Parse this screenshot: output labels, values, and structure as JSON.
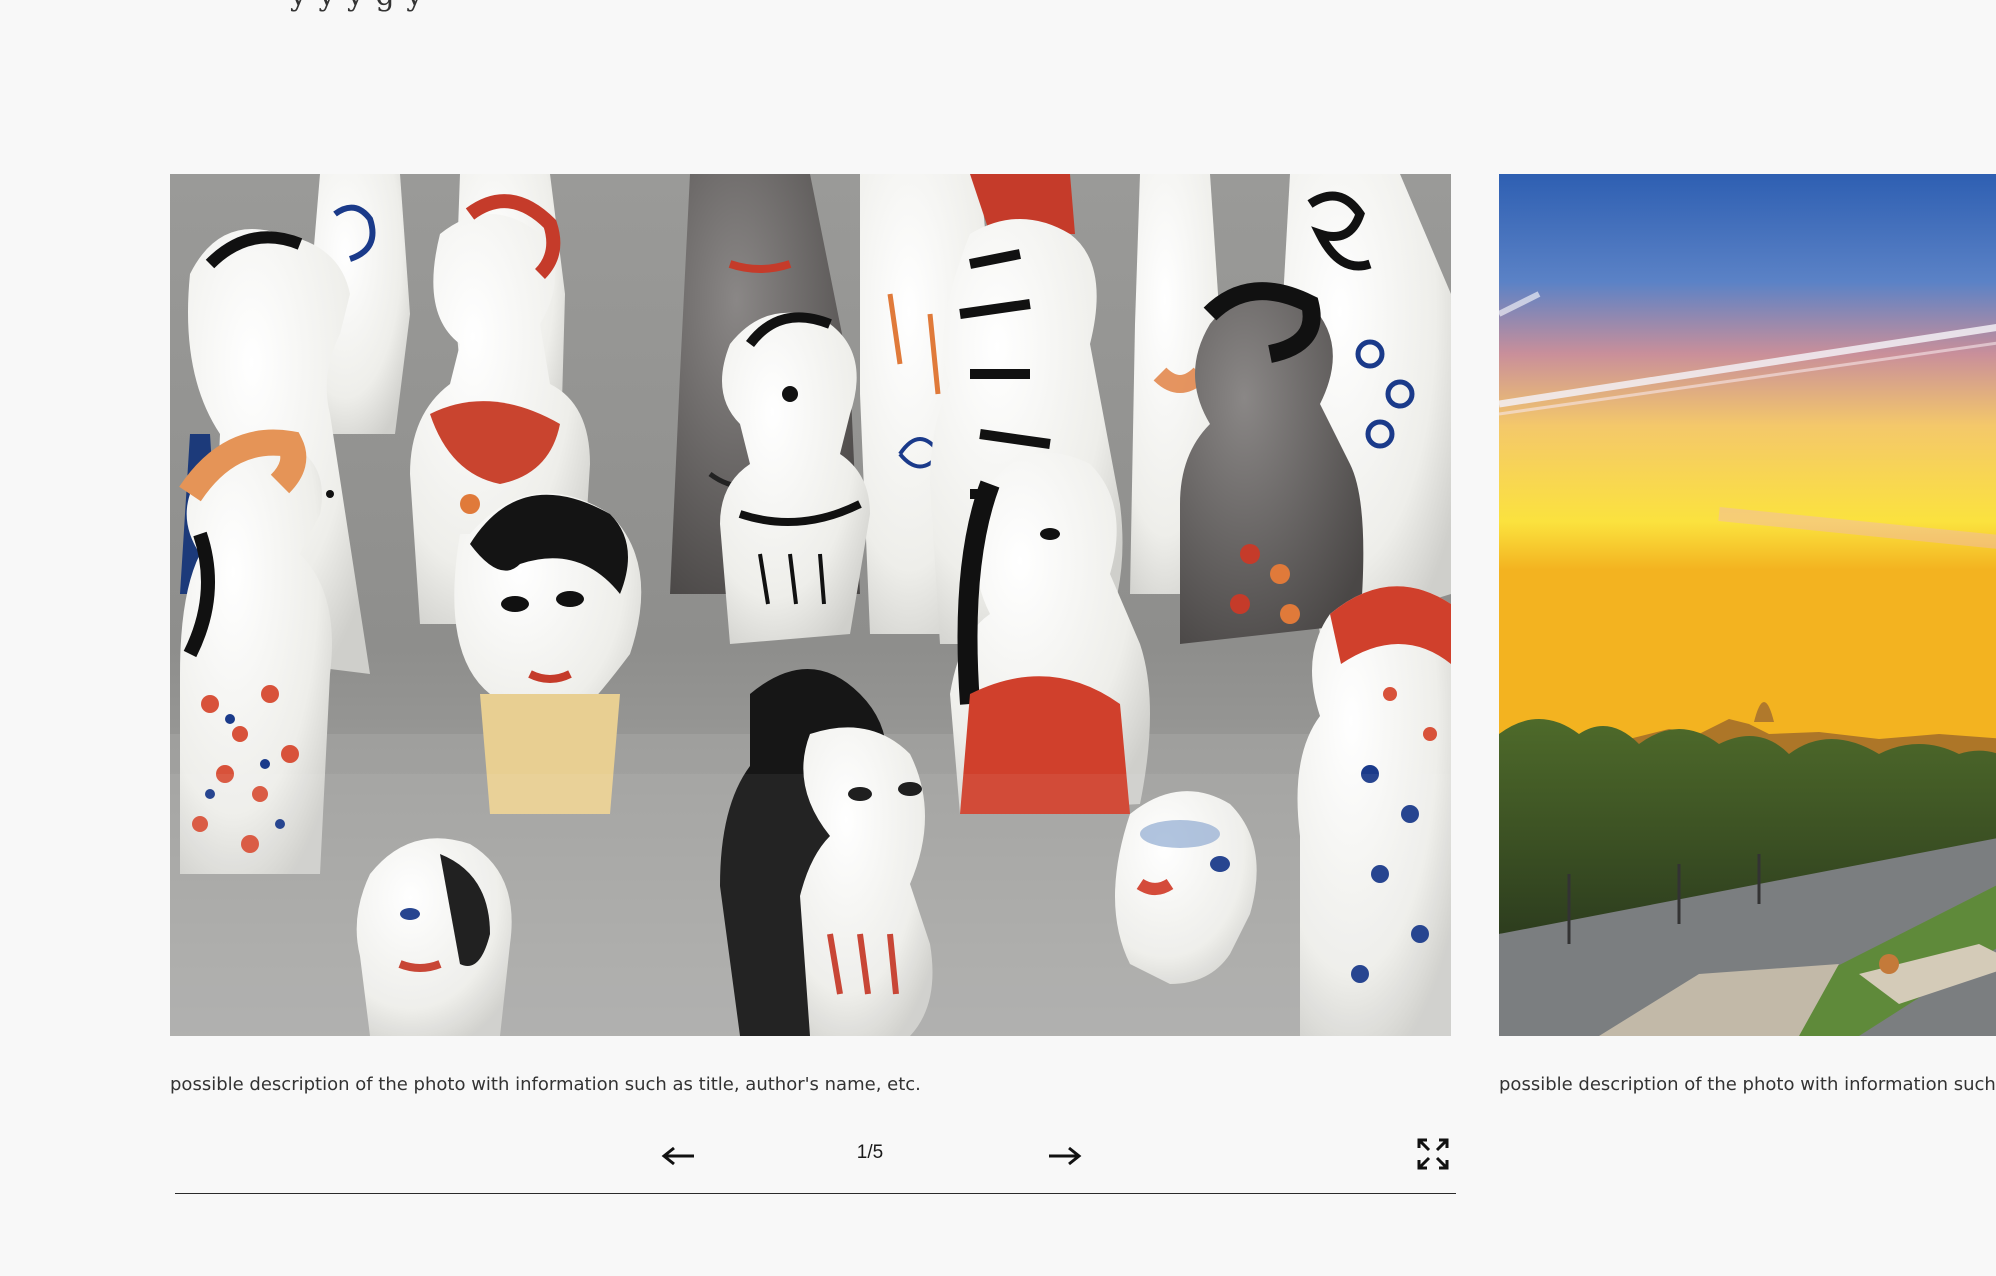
{
  "top_text_fragment": "y          y                y                    g          y",
  "slides": [
    {
      "image_alt": "Hand-painted ceramic figurines",
      "caption": "possible description of the photo with information such as title, author's name, etc."
    },
    {
      "image_alt": "Sunset over city park and skyline",
      "caption": "possible description of the photo with information such as"
    }
  ],
  "controls": {
    "prev_icon": "arrow-left-icon",
    "next_icon": "arrow-right-icon",
    "fullscreen_icon": "expand-arrows-icon",
    "counter": "1/5"
  },
  "colors": {
    "background": "#f8f8f8",
    "text": "#2b2b2b"
  }
}
